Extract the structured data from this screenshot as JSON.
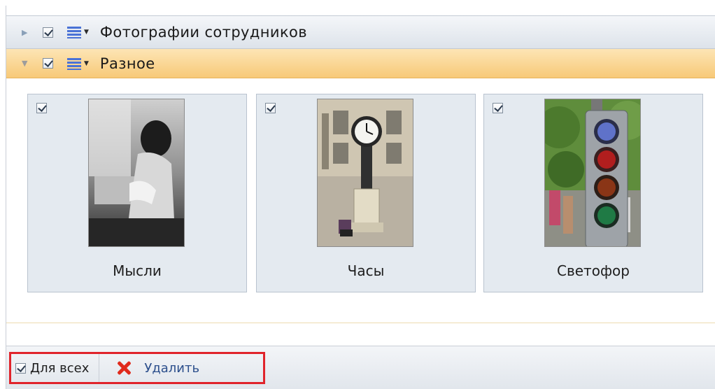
{
  "groups": [
    {
      "title": "Фотографии сотрудников",
      "expanded": false,
      "checked": true,
      "icon": "list-icon"
    },
    {
      "title": "Разное",
      "expanded": true,
      "checked": true,
      "icon": "list-icon"
    }
  ],
  "tiles": [
    {
      "label": "Мысли",
      "checked": true
    },
    {
      "label": "Часы",
      "checked": true
    },
    {
      "label": "Светофор",
      "checked": true
    }
  ],
  "toolbar": {
    "for_all_label": "Для всех",
    "for_all_checked": true,
    "delete_label": "Удалить",
    "delete_icon": "red-x-icon",
    "highlight_color": "#e0242b"
  },
  "colors": {
    "expanded_header": "#f7c978",
    "collapsed_header": "#dde3ea",
    "tile_background": "#e4eaf0",
    "list_icon": "#4a72d6"
  }
}
